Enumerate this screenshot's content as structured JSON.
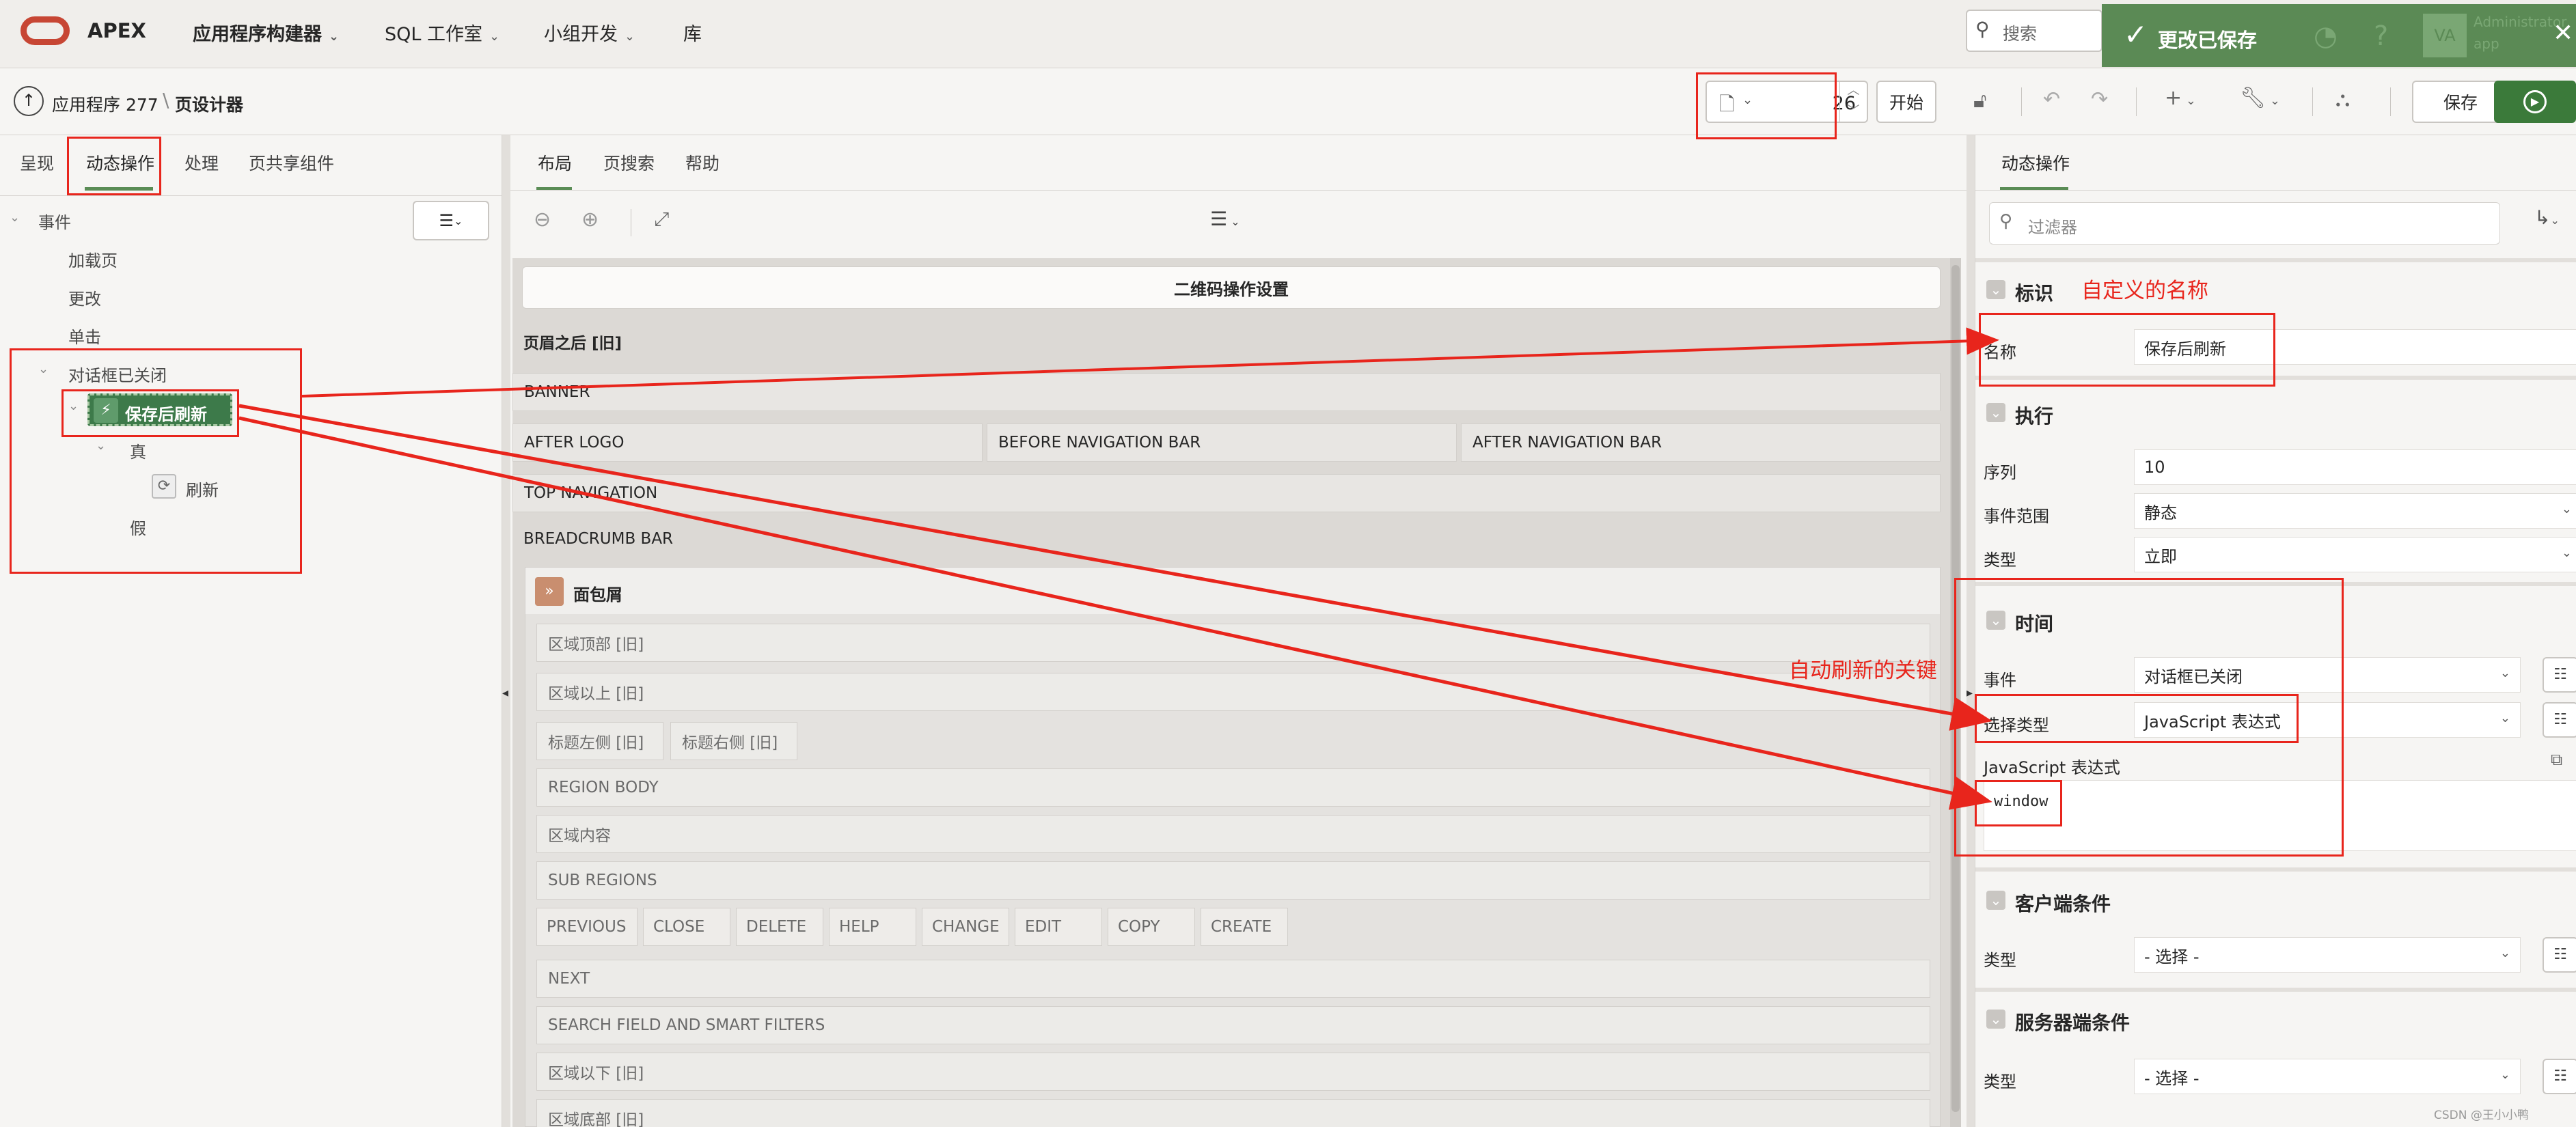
{
  "app": {
    "logo_text": "APEX"
  },
  "top_nav": {
    "items": [
      {
        "label": "应用程序构建器"
      },
      {
        "label": "SQL 工作室"
      },
      {
        "label": "小组开发"
      },
      {
        "label": "库"
      }
    ],
    "search_placeholder": "搜索",
    "avatar": "VA",
    "user_name": "Administrator",
    "user_sub": "app"
  },
  "toast": {
    "message": "更改已保存"
  },
  "breadcrumb": {
    "app": "应用程序 277",
    "page": "页设计器"
  },
  "toolbar": {
    "page_number": "26",
    "start_label": "开始",
    "save_label": "保存"
  },
  "left_panel": {
    "tabs": [
      {
        "label": "呈现"
      },
      {
        "label": "动态操作"
      },
      {
        "label": "处理"
      },
      {
        "label": "页共享组件"
      }
    ],
    "tree": {
      "root": "事件",
      "events": [
        "加载页",
        "更改",
        "单击",
        "对话框已关闭"
      ],
      "action_name": "保存后刷新",
      "true_label": "真",
      "refresh_label": "刷新",
      "false_label": "假"
    }
  },
  "mid_panel": {
    "tabs": [
      {
        "label": "布局"
      },
      {
        "label": "页搜索"
      },
      {
        "label": "帮助"
      }
    ],
    "page_title": "二维码操作设置",
    "slots": {
      "after_header": "页眉之后 [旧]",
      "banner": "BANNER",
      "after_logo": "AFTER LOGO",
      "before_nav": "BEFORE NAVIGATION BAR",
      "after_nav": "AFTER NAVIGATION BAR",
      "top_nav": "TOP NAVIGATION",
      "breadcrumb_bar": "BREADCRUMB BAR",
      "breadcrumb_region": "面包屑",
      "region_top": "区域顶部 [旧]",
      "region_above": "区域以上 [旧]",
      "title_left": "标题左侧 [旧]",
      "title_right": "标题右侧 [旧]",
      "region_body": "REGION BODY",
      "region_content": "区域内容",
      "sub_regions": "SUB REGIONS",
      "buttons": [
        "PREVIOUS",
        "CLOSE",
        "DELETE",
        "HELP",
        "CHANGE",
        "EDIT",
        "COPY",
        "CREATE"
      ],
      "next": "NEXT",
      "search_field": "SEARCH FIELD AND SMART FILTERS",
      "region_below": "区域以下 [旧]",
      "region_bottom": "区域底部 [旧]"
    }
  },
  "right_panel": {
    "tab": "动态操作",
    "filter_placeholder": "过滤器",
    "sections": {
      "identity": "标识",
      "execution": "执行",
      "timing": "时间",
      "client_condition": "客户端条件",
      "server_condition": "服务器端条件"
    },
    "fields": {
      "name_label": "名称",
      "name_value": "保存后刷新",
      "sequence_label": "序列",
      "sequence_value": "10",
      "event_scope_label": "事件范围",
      "event_scope_value": "静态",
      "type_label": "类型",
      "type_value": "立即",
      "event_label": "事件",
      "event_value": "对话框已关闭",
      "selection_type_label": "选择类型",
      "selection_type_value": "JavaScript 表达式",
      "js_expr_label": "JavaScript 表达式",
      "js_expr_value": "window",
      "client_type_label": "类型",
      "client_type_value": "- 选择 -",
      "server_type_label": "类型",
      "server_type_value": "- 选择 -"
    }
  },
  "annotations": {
    "custom_name": "自定义的名称",
    "auto_refresh_key": "自动刷新的关键"
  },
  "watermark": "CSDN @王小小鸭",
  "colors": {
    "accent": "#5a8c55",
    "annotation": "#e8251c",
    "brand": "#c74634"
  }
}
